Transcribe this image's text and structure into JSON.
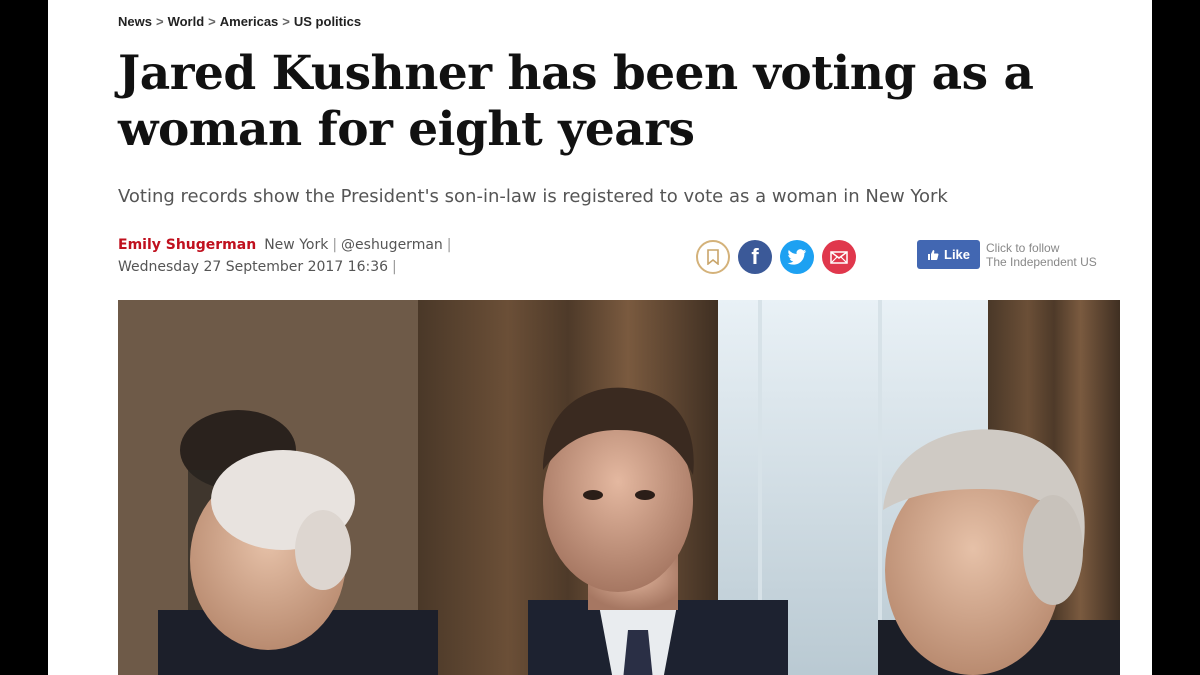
{
  "breadcrumb": {
    "items": [
      "News",
      "World",
      "Americas",
      "US politics"
    ],
    "separator": ">"
  },
  "article": {
    "headline": "Jared Kushner has been voting as a woman for eight years",
    "standfirst": "Voting records show the President's son-in-law is registered to vote as a woman in New York",
    "author": "Emily Shugerman",
    "location": "New York",
    "handle": "@eshugerman",
    "date": "Wednesday 27 September 2017 16:36",
    "divider": "|"
  },
  "share": {
    "icons": [
      "bookmark-icon",
      "facebook-icon",
      "twitter-icon",
      "email-icon"
    ],
    "facebook_glyph": "f"
  },
  "follow": {
    "like_label": "Like",
    "text_line1": "Click to follow",
    "text_line2": "The Independent US"
  },
  "colors": {
    "author_red": "#c0101e",
    "facebook": "#3b5998",
    "twitter": "#1da1f2",
    "email": "#e0374c",
    "like_button": "#4267b2"
  }
}
